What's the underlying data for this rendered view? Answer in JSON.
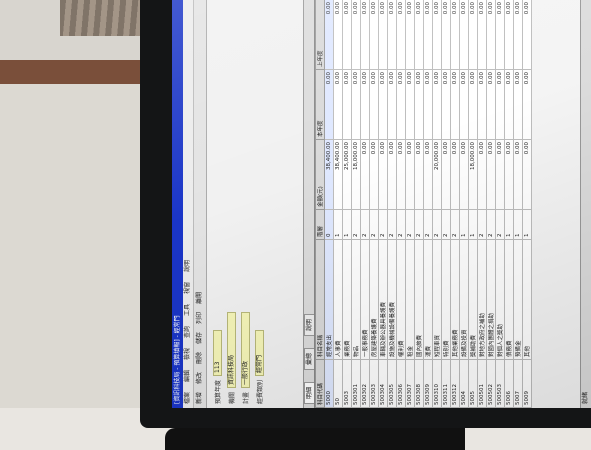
{
  "window": {
    "title": "[資訊科技局 - 預算填報] - 經常門"
  },
  "menu": [
    "檔案",
    "編輯",
    "檢視",
    "查詢",
    "工具",
    "視窗",
    "說明"
  ],
  "toolbar": [
    "新增",
    "修改",
    "刪除",
    "儲存",
    "列印",
    "離開"
  ],
  "form": {
    "row1_label": "預算年度",
    "row1_value": "113",
    "row2_label": "機關",
    "row2_value": "資訊科技局",
    "row3_label": "計畫",
    "row3_value": "一般行政",
    "row4_label": "經費類別",
    "row4_value": "經常門"
  },
  "tabs": [
    "明細",
    "彙總",
    "說明"
  ],
  "table": {
    "headers": [
      "科目代碼",
      "科目名稱",
      "階層",
      "金額(元)",
      "本年度",
      "上年度"
    ],
    "rows": [
      [
        "5000",
        "經常支出",
        "0",
        "38,400.00",
        "0.00",
        "0.00"
      ],
      [
        "50",
        "人事費",
        "1",
        "38,400.00",
        "0.00",
        "0.00"
      ],
      [
        "5003",
        "業務費",
        "1",
        "25,000.00",
        "0.00",
        "0.00"
      ],
      [
        "500301",
        "物品",
        "2",
        "18,000.00",
        "0.00",
        "0.00"
      ],
      [
        "500302",
        "一般事務費",
        "2",
        "0.00",
        "0.00",
        "0.00"
      ],
      [
        "500303",
        "房屋建築養護費",
        "2",
        "0.00",
        "0.00",
        "0.00"
      ],
      [
        "500304",
        "車輛及辦公器具養護費",
        "2",
        "0.00",
        "0.00",
        "0.00"
      ],
      [
        "500305",
        "設施及機械設備養護費",
        "2",
        "0.00",
        "0.00",
        "0.00"
      ],
      [
        "500306",
        "權利費",
        "2",
        "0.00",
        "0.00",
        "0.00"
      ],
      [
        "500307",
        "租金",
        "2",
        "0.00",
        "0.00",
        "0.00"
      ],
      [
        "500308",
        "國內旅費",
        "2",
        "0.00",
        "0.00",
        "0.00"
      ],
      [
        "500309",
        "運費",
        "2",
        "0.00",
        "0.00",
        "0.00"
      ],
      [
        "500310",
        "短程車資",
        "2",
        "20,000.00",
        "0.00",
        "0.00"
      ],
      [
        "500311",
        "特別費",
        "2",
        "0.00",
        "0.00",
        "0.00"
      ],
      [
        "500312",
        "其他業務費",
        "2",
        "0.00",
        "0.00",
        "0.00"
      ],
      [
        "5004",
        "設備及投資",
        "1",
        "0.00",
        "0.00",
        "0.00"
      ],
      [
        "5005",
        "獎補助費",
        "1",
        "18,000.00",
        "0.00",
        "0.00"
      ],
      [
        "500501",
        "對地方政府之補助",
        "2",
        "0.00",
        "0.00",
        "0.00"
      ],
      [
        "500502",
        "對國內團體之捐助",
        "2",
        "0.00",
        "0.00",
        "0.00"
      ],
      [
        "500503",
        "對個人之獎助",
        "2",
        "0.00",
        "0.00",
        "0.00"
      ],
      [
        "5006",
        "債務費",
        "1",
        "0.00",
        "0.00",
        "0.00"
      ],
      [
        "5007",
        "預備金",
        "1",
        "0.00",
        "0.00",
        "0.00"
      ],
      [
        "5009",
        "其他",
        "1",
        "0.00",
        "0.00",
        "0.00"
      ]
    ]
  },
  "status": "就緒"
}
